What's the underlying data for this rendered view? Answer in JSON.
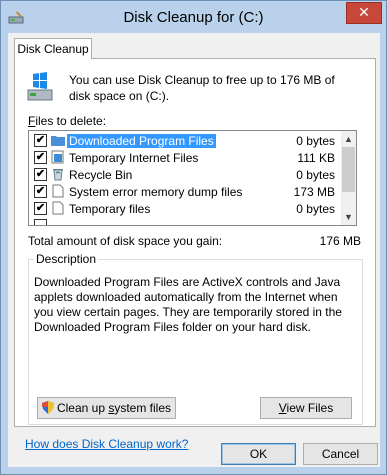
{
  "window": {
    "title": "Disk Cleanup for  (C:)",
    "close_glyph": "✕",
    "icon": "disk-cleanup-icon"
  },
  "tab": {
    "label": "Disk Cleanup"
  },
  "intro": {
    "text": "You can use Disk Cleanup to free up to 176 MB of disk space on  (C:)."
  },
  "files_to_delete": {
    "label_prefix": "F",
    "label_rest": "iles to delete:",
    "items": [
      {
        "name": "Downloaded Program Files",
        "size": "0 bytes",
        "checked": true,
        "selected": true,
        "icon": "folder-icon"
      },
      {
        "name": "Temporary Internet Files",
        "size": "111 KB",
        "checked": true,
        "selected": false,
        "icon": "internet-files-icon"
      },
      {
        "name": "Recycle Bin",
        "size": "0 bytes",
        "checked": true,
        "selected": false,
        "icon": "recycle-bin-icon"
      },
      {
        "name": "System error memory dump files",
        "size": "173 MB",
        "checked": true,
        "selected": false,
        "icon": "file-icon"
      },
      {
        "name": "Temporary files",
        "size": "0 bytes",
        "checked": true,
        "selected": false,
        "icon": "file-icon"
      }
    ],
    "check_glyph": "✔"
  },
  "total": {
    "label": "Total amount of disk space you gain:",
    "value": "176 MB"
  },
  "description": {
    "title": "Description",
    "text": "Downloaded Program Files are ActiveX controls and Java applets downloaded automatically from the Internet when you view certain pages. They are temporarily stored in the Downloaded Program Files folder on your hard disk."
  },
  "buttons": {
    "cleanup_pre": "Clean up ",
    "cleanup_ul": "s",
    "cleanup_post": "ystem files",
    "view_ul": "V",
    "view_post": "iew Files",
    "ok": "OK",
    "cancel": "Cancel"
  },
  "help_link": "How does Disk Cleanup work?",
  "colors": {
    "accent": "#3399ff",
    "link": "#0066cc",
    "close": "#c7473a"
  }
}
